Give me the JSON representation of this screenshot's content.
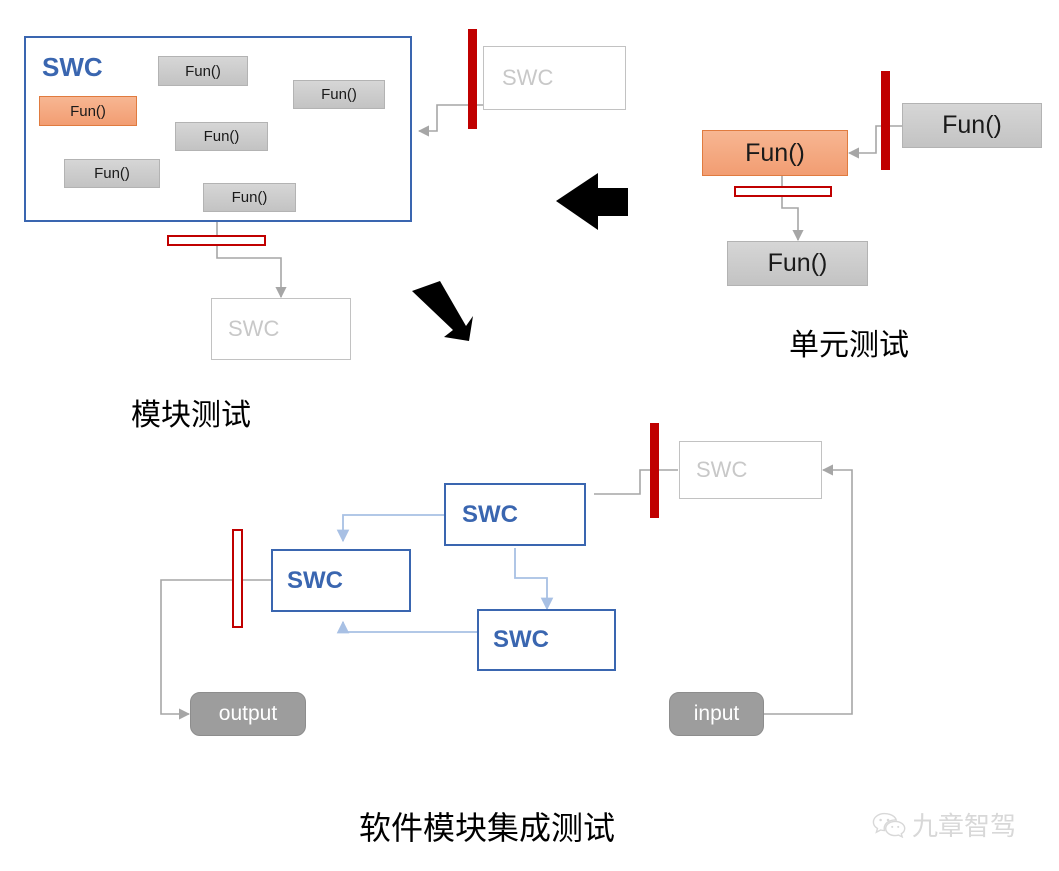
{
  "panels": {
    "module_test": {
      "title": "SWC",
      "caption": "模块测试",
      "functions": [
        {
          "label": "Fun()",
          "state": "normal"
        },
        {
          "label": "Fun()",
          "state": "highlight"
        },
        {
          "label": "Fun()",
          "state": "normal"
        },
        {
          "label": "Fun()",
          "state": "normal"
        },
        {
          "label": "Fun()",
          "state": "normal"
        },
        {
          "label": "Fun()",
          "state": "normal"
        }
      ],
      "external_swc": "SWC",
      "stub_swc": "SWC"
    },
    "unit_test": {
      "caption": "单元测试",
      "driver_function": "Fun()",
      "unit_under_test": "Fun()",
      "stub_function": "Fun()"
    },
    "integration_test": {
      "caption": "软件模块集成测试",
      "components": [
        "SWC",
        "SWC",
        "SWC"
      ],
      "external_swc": "SWC",
      "input_label": "input",
      "output_label": "output"
    }
  },
  "watermark": {
    "icon": "wechat-icon",
    "text": "九章智驾"
  },
  "colors": {
    "accent_blue": "#3a66b0",
    "harness_red": "#c00000",
    "highlight_orange": "#f29d72",
    "grey_box": "#c3c3c3",
    "ghost_grey": "#c8c8c8",
    "connector_grey": "#a6a6a6",
    "connector_blue": "#a8c0e4"
  },
  "flow_arrows": [
    {
      "name": "arrow-module-to-unit",
      "direction": "left"
    },
    {
      "name": "arrow-module-to-integration",
      "direction": "down-right"
    }
  ]
}
